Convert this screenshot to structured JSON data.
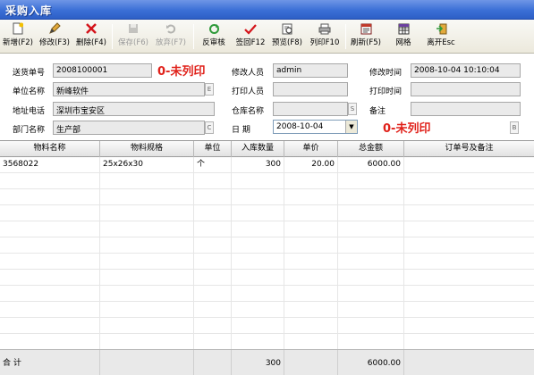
{
  "window": {
    "title": "采购入库"
  },
  "toolbar": {
    "new": "新增(F2)",
    "edit": "修改(F3)",
    "delete": "删除(F4)",
    "save": "保存(F6)",
    "discard": "放弃(F7)",
    "unaudit": "反审核",
    "signback": "签回F12",
    "preview": "预览(F8)",
    "print": "列印F10",
    "refresh": "刷新(F5)",
    "grid": "网格",
    "exit": "离开Esc"
  },
  "form": {
    "delivery_no_label": "送货单号",
    "delivery_no": "2008100001",
    "print_status": "0-未列印",
    "modifier_label": "修改人员",
    "modifier": "admin",
    "modify_time_label": "修改时间",
    "modify_time": "2008-10-04 10:10:04",
    "unit_name_label": "单位名称",
    "unit_name": "新峰软件",
    "printer_label": "打印人员",
    "printer": "",
    "print_time_label": "打印时间",
    "print_time": "",
    "phone_label": "地址电话",
    "phone": "深圳市宝安区",
    "warehouse_label": "仓库名称",
    "warehouse": "",
    "remark_label": "备注",
    "remark": "",
    "dept_label": "部门名称",
    "dept": "生产部",
    "date_label": "日  期",
    "date": "2008-10-04",
    "print_status2": "0-未列印",
    "btn_e": "E",
    "btn_c": "C",
    "btn_s": "S",
    "btn_b": "B",
    "dd_arrow": "▼"
  },
  "grid": {
    "headers": [
      "物料名称",
      "物料规格",
      "单位",
      "入库数量",
      "单价",
      "总金额",
      "订单号及备注"
    ],
    "rows": [
      [
        "3568022",
        "25x26x30",
        "个",
        "300",
        "20.00",
        "6000.00",
        ""
      ]
    ],
    "footer": {
      "label": "合 计",
      "qty_total": "300",
      "amount_total": "6000.00"
    }
  },
  "colors": {
    "titlebar": "#3b6fd6",
    "status_red": "#e0211a"
  }
}
